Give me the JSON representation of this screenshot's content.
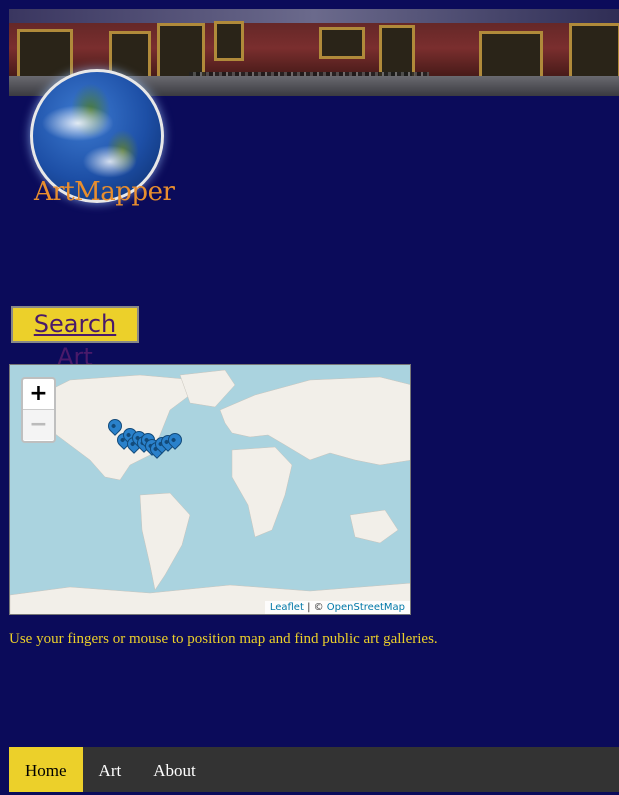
{
  "logo": {
    "text": "ArtMapper",
    "icon": "globe-icon",
    "text_color": "#e88e2e"
  },
  "search": {
    "button_label": "Search Art"
  },
  "map": {
    "zoom_in_label": "+",
    "zoom_out_label": "−",
    "attribution": {
      "leaflet": "Leaflet",
      "separator": " | © ",
      "osm": "OpenStreetMap"
    },
    "marker_icon": "map-pin-icon",
    "marker_count": 12
  },
  "instructions": "Use your fingers or mouse to position map and find public art galleries.",
  "nav": {
    "items": [
      {
        "label": "Home",
        "active": true
      },
      {
        "label": "Art",
        "active": false
      },
      {
        "label": "About",
        "active": false
      }
    ]
  },
  "colors": {
    "background": "#0b0b5a",
    "accent": "#ecd02a",
    "nav_bar": "#333333",
    "marker": "#2a81cb"
  }
}
